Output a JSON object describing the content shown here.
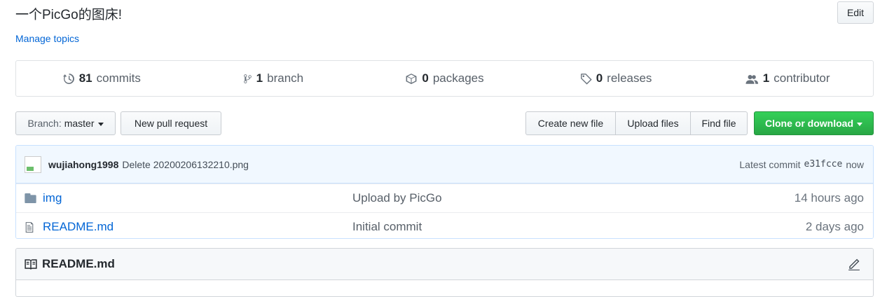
{
  "repo": {
    "description": "一个PicGo的图床!",
    "manage_topics": "Manage topics",
    "edit_label": "Edit"
  },
  "summary": [
    {
      "icon": "history-icon",
      "count": "81",
      "label": "commits"
    },
    {
      "icon": "branch-icon",
      "count": "1",
      "label": "branch"
    },
    {
      "icon": "package-icon",
      "count": "0",
      "label": "packages"
    },
    {
      "icon": "tag-icon",
      "count": "0",
      "label": "releases"
    },
    {
      "icon": "people-icon",
      "count": "1",
      "label": "contributor"
    }
  ],
  "toolbar": {
    "branch_label": "Branch:",
    "branch_value": "master",
    "new_pr": "New pull request",
    "create_file": "Create new file",
    "upload_files": "Upload files",
    "find_file": "Find file",
    "clone": "Clone or download"
  },
  "commit": {
    "author": "wujiahong1998",
    "message": "Delete 20200206132210.png",
    "latest_label": "Latest commit",
    "sha": "e31fcce",
    "time": "now"
  },
  "files": [
    {
      "type": "folder",
      "icon": "folder-icon",
      "name": "img",
      "message": "Upload by PicGo",
      "age": "14 hours ago"
    },
    {
      "type": "file",
      "icon": "file-icon",
      "name": "README.md",
      "message": "Initial commit",
      "age": "2 days ago"
    }
  ],
  "readme": {
    "title": "README.md"
  },
  "colors": {
    "link": "#0366d6",
    "clone_button": "#28a745",
    "commit_bar": "#f1f8ff"
  }
}
